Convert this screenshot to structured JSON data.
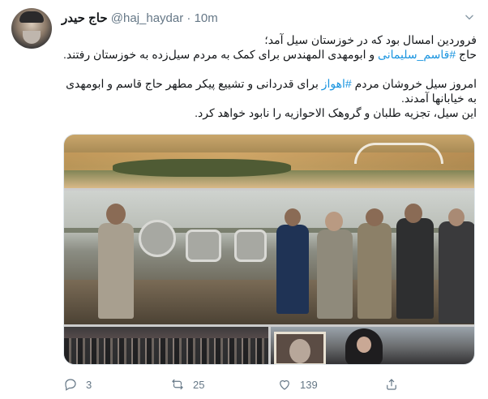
{
  "tweet": {
    "author_name": "حاج حیدر",
    "handle": "@haj_haydar",
    "separator": "·",
    "time": "10m",
    "lines": {
      "l1": "فروردین امسال بود که در خوزستان سیل آمد؛",
      "l2_prefix": "حاج ",
      "l2_hashtag": "#قاسم_سلیمانی",
      "l2_suffix": " و ابومهدی المهندس برای کمک به مردم سیل‌زده به خوزستان رفتند.",
      "l3_prefix": "امروز سیل خروشان مردم ",
      "l3_hashtag": "#اهواز",
      "l3_suffix": " برای قدردانی و تشییع پیکر مطهر حاج قاسم و ابومهدی به خیابانها آمدند.",
      "l4": "این سیل، تجزیه طلبان و گروهک الاحوازیه را نابود خواهد کرد."
    },
    "actions": {
      "reply_count": "3",
      "retweet_count": "25",
      "like_count": "139"
    },
    "icons": {
      "menu": "chevron-down-icon",
      "reply": "reply-icon",
      "retweet": "retweet-icon",
      "like": "heart-icon",
      "share": "share-icon"
    },
    "colors": {
      "link": "#1b95e0",
      "secondary_text": "#657786",
      "primary_text": "#14171a"
    }
  }
}
